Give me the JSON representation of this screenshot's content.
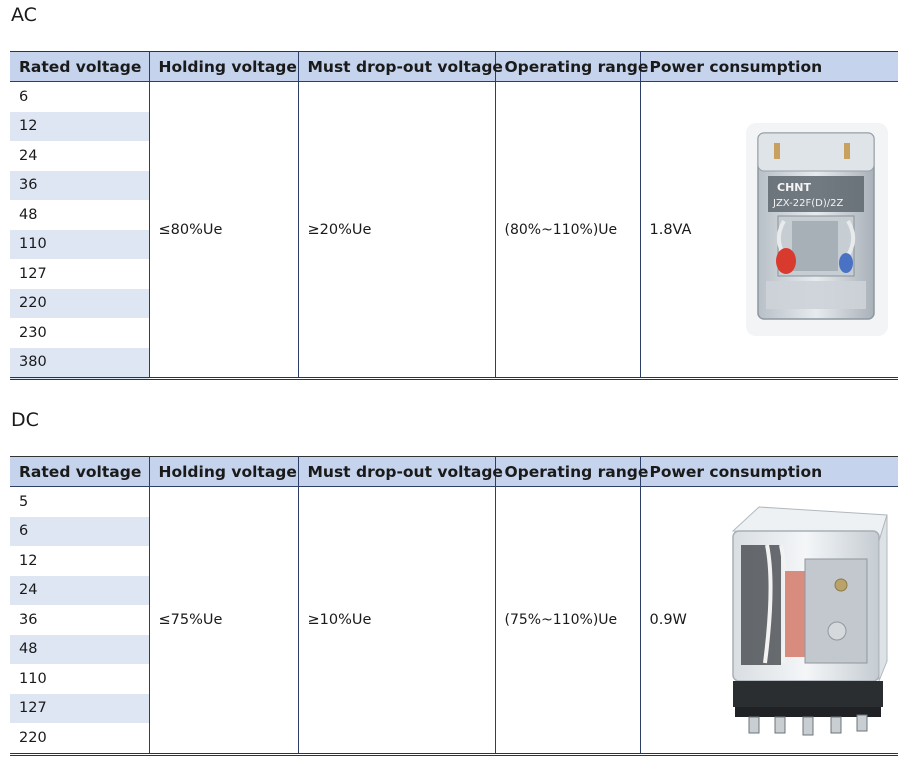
{
  "ac": {
    "title": "AC",
    "headers": [
      "Rated voltage",
      "Holding voltage",
      "Must drop-out voltage",
      "Operating range",
      "Power consumption"
    ],
    "rated_voltages": [
      "6",
      "12",
      "24",
      "36",
      "48",
      "110",
      "127",
      "220",
      "230",
      "380"
    ],
    "holding_voltage": "≤80%Ue",
    "drop_out_voltage": "≥20%Ue",
    "operating_range": "(80%~110%)Ue",
    "power_consumption": "1.8VA",
    "relay_brand": "CHNT",
    "relay_model": "JZX-22F(D)/2Z"
  },
  "dc": {
    "title": "DC",
    "headers": [
      "Rated voltage",
      "Holding voltage",
      "Must drop-out voltage",
      "Operating range",
      "Power consumption"
    ],
    "rated_voltages": [
      "5",
      "6",
      "12",
      "24",
      "36",
      "48",
      "110",
      "127",
      "220"
    ],
    "holding_voltage": "≤75%Ue",
    "drop_out_voltage": "≥10%Ue",
    "operating_range": "(75%~110%)Ue",
    "power_consumption": "0.9W"
  },
  "colors": {
    "header_bg": "#c5d4ec",
    "alt_row_bg": "#dee6f4",
    "grid_line": "#2c3e66"
  }
}
